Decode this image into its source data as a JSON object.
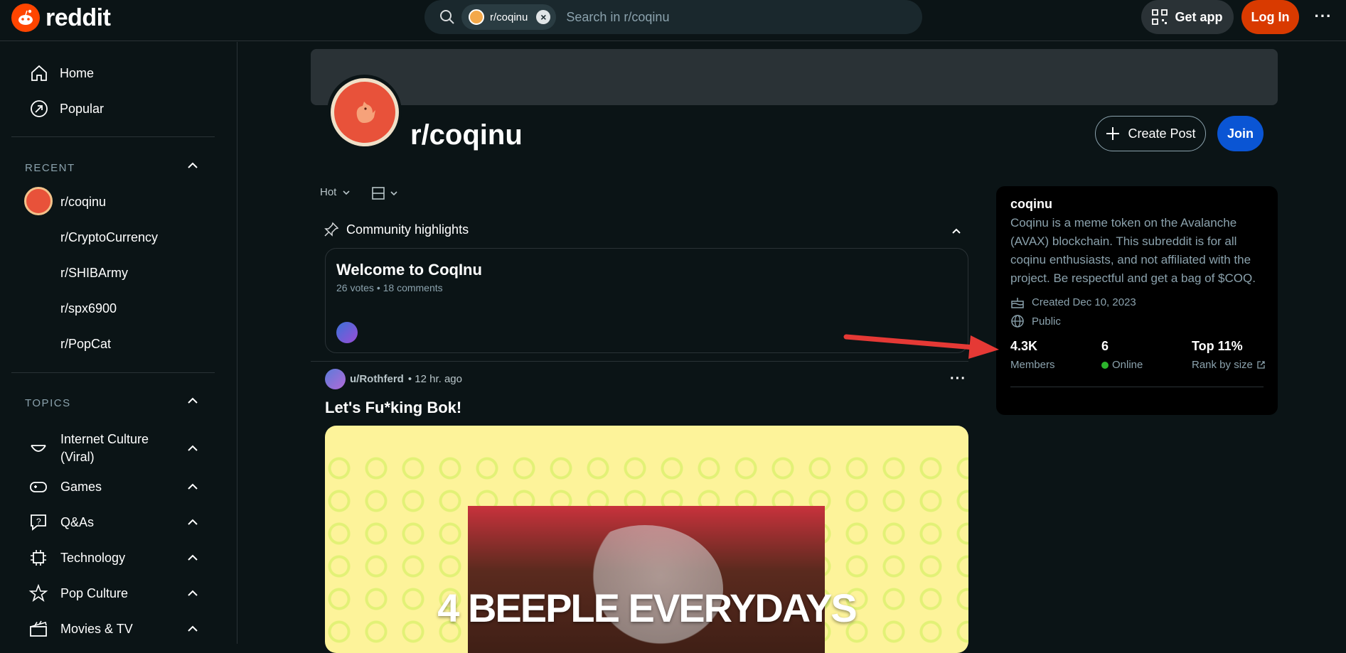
{
  "brand": {
    "name": "reddit"
  },
  "search": {
    "chip_label": "r/coqinu",
    "placeholder": "Search in r/coqinu"
  },
  "header": {
    "get_app": "Get app",
    "login": "Log In",
    "more": "···"
  },
  "sidebar": {
    "nav": [
      {
        "label": "Home",
        "icon": "home-icon"
      },
      {
        "label": "Popular",
        "icon": "popular-icon"
      }
    ],
    "recent_label": "RECENT",
    "recent": [
      "r/coqinu",
      "r/CryptoCurrency",
      "r/SHIBArmy",
      "r/spx6900",
      "r/PopCat"
    ],
    "topics_label": "TOPICS",
    "topics": [
      {
        "label": "Internet Culture (Viral)",
        "icon": "smile-icon"
      },
      {
        "label": "Games",
        "icon": "gamepad-icon"
      },
      {
        "label": "Q&As",
        "icon": "question-icon"
      },
      {
        "label": "Technology",
        "icon": "chip-icon"
      },
      {
        "label": "Pop Culture",
        "icon": "star-icon"
      },
      {
        "label": "Movies & TV",
        "icon": "clapper-icon"
      }
    ]
  },
  "subreddit": {
    "name": "r/coqinu",
    "create_post": "Create Post",
    "join": "Join",
    "sort": "Hot",
    "highlights_label": "Community highlights",
    "highlight": {
      "title": "Welcome to CoqInu",
      "meta": "26 votes • 18 comments"
    }
  },
  "post": {
    "author": "u/Rothferd",
    "time": "• 12 hr. ago",
    "title": "Let's Fu*king Bok!",
    "media_caption": "4 BEEPLE EVERYDAYS",
    "more": "···"
  },
  "about": {
    "name": "coqinu",
    "description": "Coqinu is a meme token on the Avalanche (AVAX) blockchain. This subreddit is for all coqinu enthusiasts, and not affiliated with the project. Be respectful and get a bag of $COQ.",
    "created": "Created Dec 10, 2023",
    "visibility": "Public",
    "stats": [
      {
        "value": "4.3K",
        "label": "Members"
      },
      {
        "value": "6",
        "label": "Online"
      },
      {
        "value": "Top 11%",
        "label": "Rank by size"
      }
    ]
  },
  "colors": {
    "accent_orange": "#d93a00",
    "join_blue": "#0a55d4",
    "online_green": "#2cb52c",
    "annotation_red": "#e53935"
  }
}
